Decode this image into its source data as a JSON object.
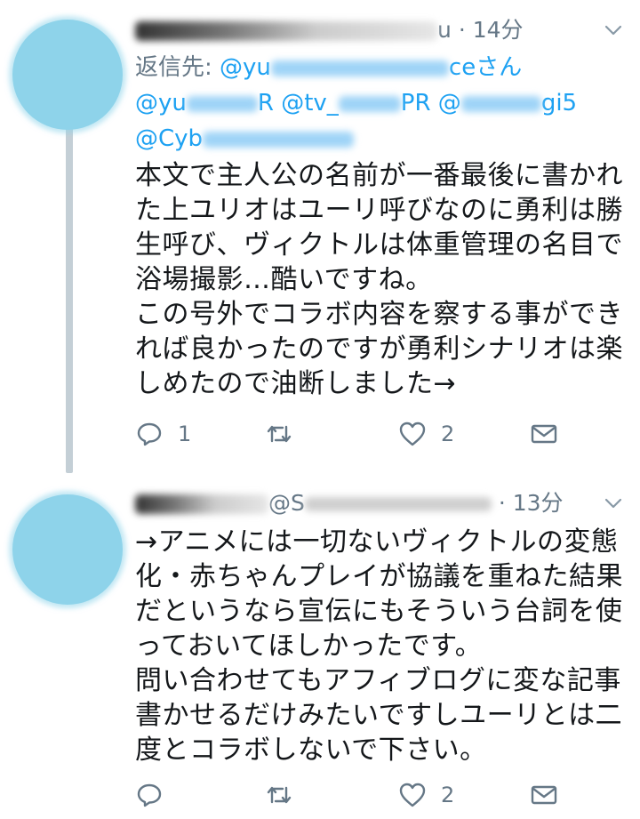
{
  "colors": {
    "accent": "#1da1f2",
    "muted": "#657786",
    "thread_line": "#c4cfd6",
    "avatar": "#8ed3ea"
  },
  "tweets": [
    {
      "handle_tail": "u",
      "time": "· 14分",
      "reply_prefix": "返信先:",
      "mentions_line1": "@yu",
      "mentions_line1_tail": "ceさん",
      "mentions_line2_a": "@yu",
      "mentions_line2_b": "R @tv_",
      "mentions_line2_c": "PR @",
      "mentions_line2_d": "gi5",
      "mentions_line3": "@Cyb",
      "text": "本文で主人公の名前が一番最後に書かれ\nた上ユリオはユーリ呼びなのに勇利は勝\n生呼び、ヴィクトルは体重管理の名目で\n浴場撮影…酷いですね。\nこの号外でコラボ内容を察する事ができ\nれば良かったのですが勇利シナリオは楽\nしめたので油断しました→",
      "reply_count": "1",
      "retweet_count": "",
      "like_count": "2"
    },
    {
      "handle_tail": "@S",
      "time": "· 13分",
      "text": "→アニメには一切ないヴィクトルの変態\n化・赤ちゃんプレイが協議を重ねた結果\nだというなら宣伝にもそういう台詞を使\nっておいてほしかったです。\n問い合わせてもアフィブログに変な記事\n書かせるだけみたいですしユーリとは二\n度とコラボしないで下さい。",
      "reply_count": "",
      "retweet_count": "",
      "like_count": "2"
    }
  ]
}
